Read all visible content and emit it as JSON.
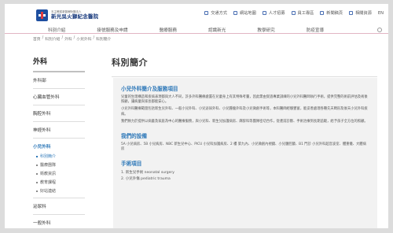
{
  "header": {
    "logo_sub": "天主教耕莘醫療財團法人",
    "logo_name": "新光吳火獅紀念醫院",
    "utility": [
      "交通方式",
      "網站地圖",
      "人才招募",
      "員工專區",
      "新聞稿頁",
      "相關資源",
      "EN"
    ]
  },
  "nav": {
    "items": [
      "科別介紹",
      "掛號服務及申請",
      "醫療服務",
      "認識新光",
      "教學研究",
      "防疫宣導"
    ]
  },
  "breadcrumb": [
    "首頁",
    "科別介紹",
    "外科",
    "小兒外科",
    "科別簡介"
  ],
  "sidebar": {
    "heading": "外科",
    "items": [
      {
        "label": "外科部"
      },
      {
        "label": "心臟血管外科"
      },
      {
        "label": "胸腔外科"
      },
      {
        "label": "神經外科"
      },
      {
        "label": "小兒外科",
        "active": true
      }
    ],
    "subitems": [
      {
        "label": "科別簡介",
        "active": true
      },
      {
        "label": "醫療團隊"
      },
      {
        "label": "衛教資訊"
      },
      {
        "label": "教育課程"
      },
      {
        "label": "好站連結"
      }
    ],
    "after": [
      {
        "label": "泌尿科"
      },
      {
        "label": "一般外科"
      }
    ]
  },
  "main": {
    "title": "科別簡介",
    "sec1_title": "小兒外科簡介及服務項目",
    "sec1_p1": "兒童的生理構造和疾病表現都與大人不同，許多外科醫療處置在兒童身上有其特殊考量，因此需由受過專業訓練的小兒外科醫師執行手術，提供完整的術前評估及術後照顧，讓病童與家長都能安心。",
    "sec1_p2": "小兒外科醫療範圍包括新生兒外科、一般小兒外科、小兒泌尿外科、小兒腫瘤外科及小兒微創手術等，本科醫師經驗豐富，能妥善處理各種先天畸形及後天小兒外科疾病。",
    "sec1_p3": "我們致力於提供以病童及家庭為中心的醫療服務，與小兒科、新生兒加護病房、麻醉科等團隊密切合作，從產前診斷、手術治療到長期追蹤，給予孩子全方位的照顧。",
    "sec2_title": "我們的設備",
    "sec2_p1": "5A 小兒病房、5B 小兒病房、NBC 新生兒中心、PICU 小兒科加護病房、2 樓 第九內、小兒微創內視鏡、小兒腹腔鏡、B1 門診 小兒外科超音波室、體重儀、大體病房",
    "sec3_title": "手術項目",
    "procedures": [
      "1. 新生兒手術 neonatal surgery",
      "2. 小兒外傷 pediatric trauma"
    ]
  }
}
